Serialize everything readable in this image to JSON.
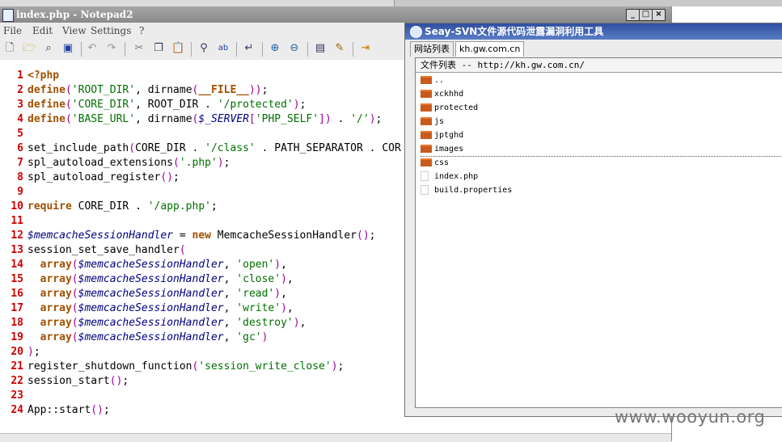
{
  "notepad": {
    "title": "index.php - Notepad2",
    "window_buttons": [
      "_",
      "□",
      "×"
    ],
    "menu": [
      "File",
      "Edit",
      "View",
      "Settings",
      "?"
    ],
    "toolbar_icons": [
      "new-icon",
      "open-icon",
      "browse-icon",
      "save-icon",
      "undo-icon",
      "redo-icon",
      "cut-icon",
      "copy-icon",
      "paste-icon",
      "find-icon",
      "replace-icon",
      "wordwrap-icon",
      "zoom-in-icon",
      "zoom-out-icon",
      "view-icon",
      "settings-icon",
      "exit-icon"
    ],
    "lines": [
      {
        "n": "1",
        "html": "<span class='kw'>&lt;?php</span>"
      },
      {
        "n": "2",
        "html": "<span class='kw'>define</span><span class='pun'>(</span><span class='str'>'ROOT_DIR'</span>, dirname<span class='pun'>(</span><span class='kw'>__FILE__</span><span class='pun'>))</span>;"
      },
      {
        "n": "3",
        "html": "<span class='kw'>define</span><span class='pun'>(</span><span class='str'>'CORE_DIR'</span>, ROOT_DIR . <span class='str'>'/protected'</span><span class='pun'>)</span>;"
      },
      {
        "n": "4",
        "html": "<span class='kw'>define</span><span class='pun'>(</span><span class='str'>'BASE_URL'</span>, dirname<span class='pun'>(</span><span class='var'>$_SERVER</span><span class='pun'>[</span><span class='str'>'PHP_SELF'</span><span class='pun'>])</span> . <span class='str'>'/'</span><span class='pun'>)</span>;"
      },
      {
        "n": "5",
        "html": ""
      },
      {
        "n": "6",
        "html": "set_include_path<span class='pun'>(</span>CORE_DIR . <span class='str'>'/class'</span> . PATH_SEPARATOR . COR"
      },
      {
        "n": "7",
        "html": "spl_autoload_extensions<span class='pun'>(</span><span class='str'>'.php'</span><span class='pun'>)</span>;"
      },
      {
        "n": "8",
        "html": "spl_autoload_register<span class='pun'>()</span>;"
      },
      {
        "n": "9",
        "html": ""
      },
      {
        "n": "10",
        "html": "<span class='kw'>require</span> CORE_DIR . <span class='str'>'/app.php'</span>;"
      },
      {
        "n": "11",
        "html": ""
      },
      {
        "n": "12",
        "html": "<span class='var'>$memcacheSessionHandler</span> = <span class='kw'>new</span> MemcacheSessionHandler<span class='pun'>()</span>;"
      },
      {
        "n": "13",
        "html": "session_set_save_handler<span class='pun'>(</span>"
      },
      {
        "n": "14",
        "html": "  <span class='kw'>array</span><span class='pun'>(</span><span class='var'>$memcacheSessionHandler</span>, <span class='str'>'open'</span><span class='pun'>)</span>,"
      },
      {
        "n": "15",
        "html": "  <span class='kw'>array</span><span class='pun'>(</span><span class='var'>$memcacheSessionHandler</span>, <span class='str'>'close'</span><span class='pun'>)</span>,"
      },
      {
        "n": "16",
        "html": "  <span class='kw'>array</span><span class='pun'>(</span><span class='var'>$memcacheSessionHandler</span>, <span class='str'>'read'</span><span class='pun'>)</span>,"
      },
      {
        "n": "17",
        "html": "  <span class='kw'>array</span><span class='pun'>(</span><span class='var'>$memcacheSessionHandler</span>, <span class='str'>'write'</span><span class='pun'>)</span>,"
      },
      {
        "n": "18",
        "html": "  <span class='kw'>array</span><span class='pun'>(</span><span class='var'>$memcacheSessionHandler</span>, <span class='str'>'destroy'</span><span class='pun'>)</span>,"
      },
      {
        "n": "19",
        "html": "  <span class='kw'>array</span><span class='pun'>(</span><span class='var'>$memcacheSessionHandler</span>, <span class='str'>'gc'</span><span class='pun'>)</span>"
      },
      {
        "n": "20",
        "html": "<span class='pun'>)</span>;"
      },
      {
        "n": "21",
        "html": "register_shutdown_function<span class='pun'>(</span><span class='str'>'session_write_close'</span><span class='pun'>)</span>;"
      },
      {
        "n": "22",
        "html": "session_start<span class='pun'>()</span>;"
      },
      {
        "n": "23",
        "html": ""
      },
      {
        "n": "24",
        "html": "App::start<span class='pun'>()</span>;"
      }
    ]
  },
  "seay": {
    "title": "Seay-SVN文件源代码泄露漏洞利用工具",
    "tabs": [
      "网站列表",
      "kh.gw.com.cn"
    ],
    "header": "文件列表 -- http://kh.gw.com.cn/",
    "files": [
      {
        "name": "..",
        "type": "folder"
      },
      {
        "name": "xckhhd",
        "type": "folder"
      },
      {
        "name": "protected",
        "type": "folder"
      },
      {
        "name": "js",
        "type": "folder"
      },
      {
        "name": "jptghd",
        "type": "folder"
      },
      {
        "name": "images",
        "type": "folder",
        "selected": true
      },
      {
        "name": "css",
        "type": "folder"
      },
      {
        "name": "index.php",
        "type": "file"
      },
      {
        "name": "build.properties",
        "type": "file"
      }
    ]
  },
  "watermark": "www.wooyun.org"
}
